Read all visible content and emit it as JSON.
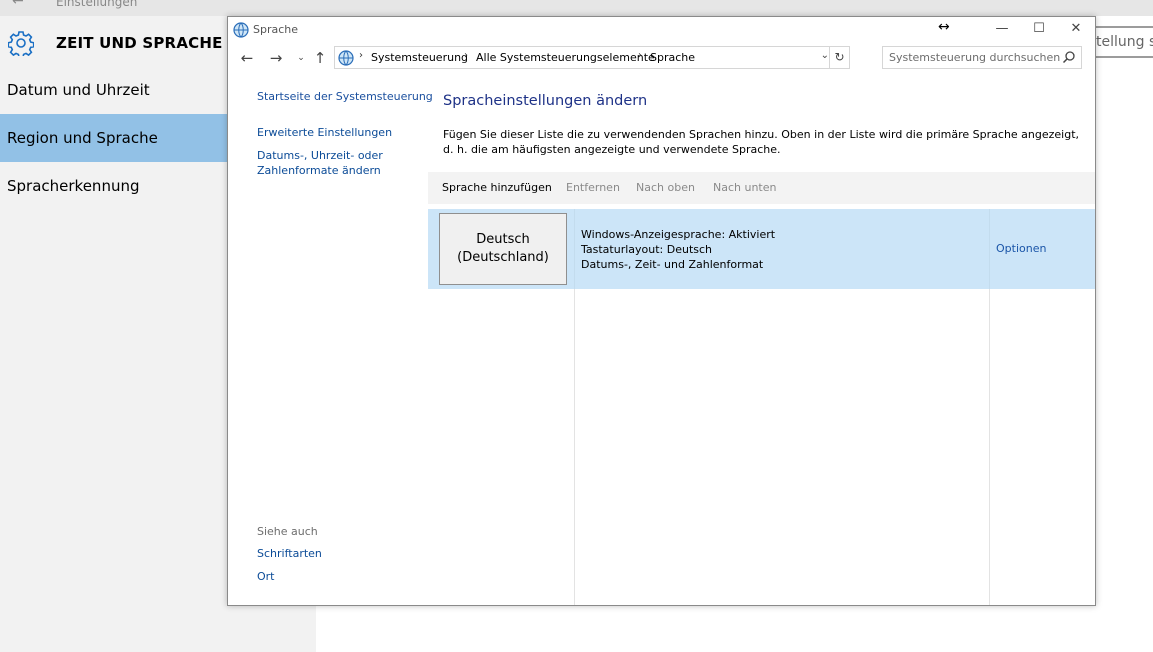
{
  "settings": {
    "app_title": "Einstellungen",
    "section_title": "ZEIT UND SPRACHE",
    "search_partial": "tellung su",
    "nav": [
      {
        "label": "Datum und Uhrzeit",
        "active": false
      },
      {
        "label": "Region und Sprache",
        "active": true
      },
      {
        "label": "Spracherkennung",
        "active": false
      }
    ]
  },
  "window": {
    "title": "Sprache",
    "breadcrumbs": [
      "Systemsteuerung",
      "Alle Systemsteuerungselemente",
      "Sprache"
    ],
    "search_placeholder": "Systemsteuerung durchsuchen"
  },
  "left_panel": {
    "home_link": "Startseite der Systemsteuerung",
    "links": [
      "Erweiterte Einstellungen",
      "Datums-, Uhrzeit- oder",
      "Zahlenformate ändern"
    ],
    "see_also_title": "Siehe auch",
    "see_also_links": [
      "Schriftarten",
      "Ort"
    ]
  },
  "main": {
    "heading": "Spracheinstellungen ändern",
    "description": "Fügen Sie dieser Liste die zu verwendenden Sprachen hinzu. Oben in der Liste wird die primäre Sprache angezeigt, d. h. die am häufigsten angezeigte und verwendete Sprache.",
    "toolbar": {
      "add": "Sprache hinzufügen",
      "remove": "Entfernen",
      "up": "Nach oben",
      "down": "Nach unten"
    },
    "languages": [
      {
        "name_line1": "Deutsch",
        "name_line2": "(Deutschland)",
        "info": [
          "Windows-Anzeigesprache: Aktiviert",
          "Tastaturlayout: Deutsch",
          "Datums-, Zeit- und Zahlenformat"
        ],
        "options_label": "Optionen"
      }
    ]
  },
  "colors": {
    "selection": "#92c1e6",
    "row_highlight": "#cce5f8",
    "link": "#0b4b97",
    "heading": "#1e3287"
  }
}
